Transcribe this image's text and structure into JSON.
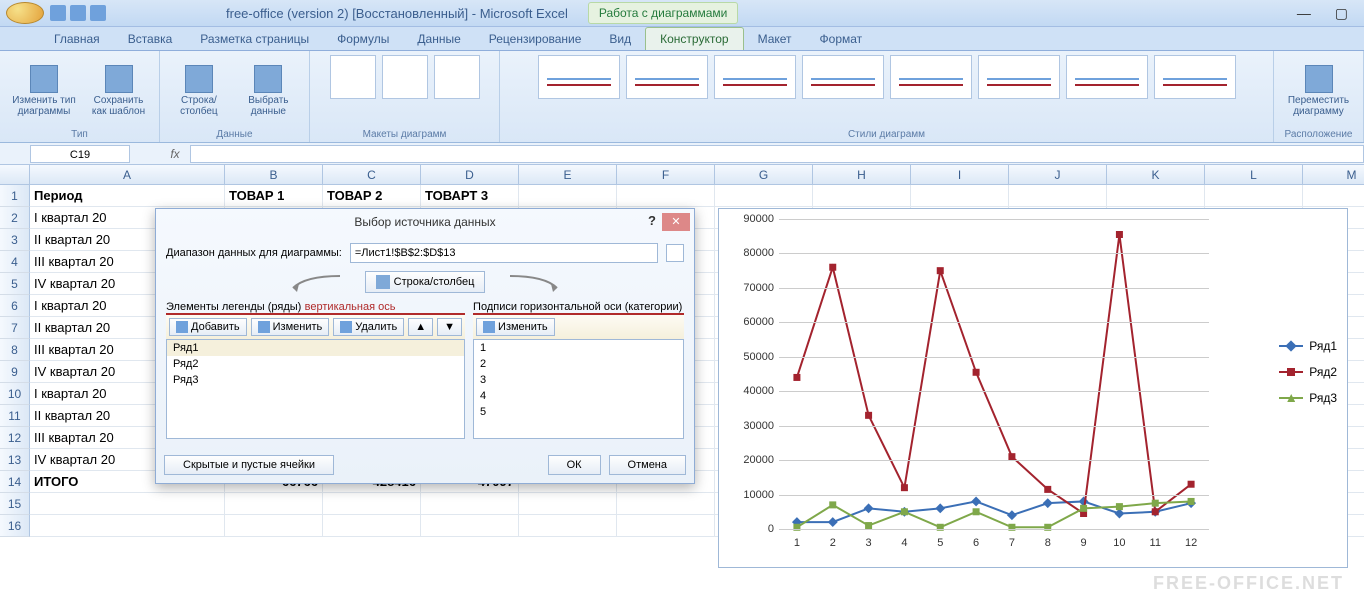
{
  "title": "free-office (version 2) [Восстановленный] - Microsoft Excel",
  "chart_tools_label": "Работа с диаграммами",
  "tabs": [
    "Главная",
    "Вставка",
    "Разметка страницы",
    "Формулы",
    "Данные",
    "Рецензирование",
    "Вид",
    "Конструктор",
    "Макет",
    "Формат"
  ],
  "active_tab": 7,
  "ribbon": {
    "group_type": "Тип",
    "btn_change_type": "Изменить тип\nдиаграммы",
    "btn_save_template": "Сохранить\nкак шаблон",
    "group_data": "Данные",
    "btn_switch": "Строка/столбец",
    "btn_select": "Выбрать\nданные",
    "group_layouts": "Макеты диаграмм",
    "group_styles": "Стили диаграмм",
    "group_location": "Расположение",
    "btn_move": "Переместить\nдиаграмму"
  },
  "namebox": "C19",
  "columns": [
    "A",
    "B",
    "C",
    "D",
    "E",
    "F",
    "G",
    "H",
    "I",
    "J",
    "K",
    "L",
    "M"
  ],
  "rows": [
    {
      "n": 1,
      "A": "Период",
      "B": "ТОВАР 1",
      "C": "ТОВАР 2",
      "D": "ТОВАРТ 3",
      "bold": true
    },
    {
      "n": 2,
      "A": "I квартал 20"
    },
    {
      "n": 3,
      "A": "II квартал 20"
    },
    {
      "n": 4,
      "A": "III квартал 20"
    },
    {
      "n": 5,
      "A": "IV квартал 20"
    },
    {
      "n": 6,
      "A": "I квартал 20"
    },
    {
      "n": 7,
      "A": "II квартал 20"
    },
    {
      "n": 8,
      "A": "III квартал 20"
    },
    {
      "n": 9,
      "A": "IV квартал 20"
    },
    {
      "n": 10,
      "A": "I квартал 20"
    },
    {
      "n": 11,
      "A": "II квартал 20"
    },
    {
      "n": 12,
      "A": "III квартал 20"
    },
    {
      "n": 13,
      "A": "IV квартал 20"
    },
    {
      "n": 14,
      "A": "ИТОГО",
      "B": "66766",
      "C": "428416",
      "D": "47097",
      "bold": true,
      "right": true
    },
    {
      "n": 15,
      "A": ""
    },
    {
      "n": 16,
      "A": ""
    }
  ],
  "dialog": {
    "title": "Выбор источника данных",
    "range_label": "Диапазон данных для диаграммы:",
    "range_value": "=Лист1!$B$2:$D$13",
    "swap_btn": "Строка/столбец",
    "legend_title": "Элементы легенды (ряды)",
    "axis_accent": "вертикальная ось",
    "cat_title": "Подписи горизонтальной оси (категории)",
    "add": "Добавить",
    "edit": "Изменить",
    "delete": "Удалить",
    "edit2": "Изменить",
    "series": [
      "Ряд1",
      "Ряд2",
      "Ряд3"
    ],
    "categories": [
      "1",
      "2",
      "3",
      "4",
      "5"
    ],
    "hidden_btn": "Скрытые и пустые ячейки",
    "ok": "ОК",
    "cancel": "Отмена"
  },
  "chart_data": {
    "type": "line",
    "x": [
      1,
      2,
      3,
      4,
      5,
      6,
      7,
      8,
      9,
      10,
      11,
      12
    ],
    "ylim": [
      0,
      90000
    ],
    "yticks": [
      0,
      10000,
      20000,
      30000,
      40000,
      50000,
      60000,
      70000,
      80000,
      90000
    ],
    "series": [
      {
        "name": "Ряд1",
        "color": "#3b6fb6",
        "marker": "diamond",
        "values": [
          2000,
          2000,
          6000,
          5000,
          6000,
          8000,
          4000,
          7500,
          8000,
          4500,
          5000,
          7500
        ]
      },
      {
        "name": "Ряд2",
        "color": "#a3232e",
        "marker": "square",
        "values": [
          44000,
          76000,
          33000,
          12000,
          75000,
          45500,
          21000,
          11500,
          4500,
          85500,
          5000,
          13000
        ]
      },
      {
        "name": "Ряд3",
        "color": "#7fa84a",
        "marker": "triangle",
        "values": [
          500,
          7000,
          1000,
          5000,
          500,
          5000,
          500,
          500,
          6000,
          6500,
          7500,
          8000
        ]
      }
    ]
  },
  "legend": [
    "Ряд1",
    "Ряд2",
    "Ряд3"
  ],
  "watermark": "FREE-OFFICE.NET"
}
